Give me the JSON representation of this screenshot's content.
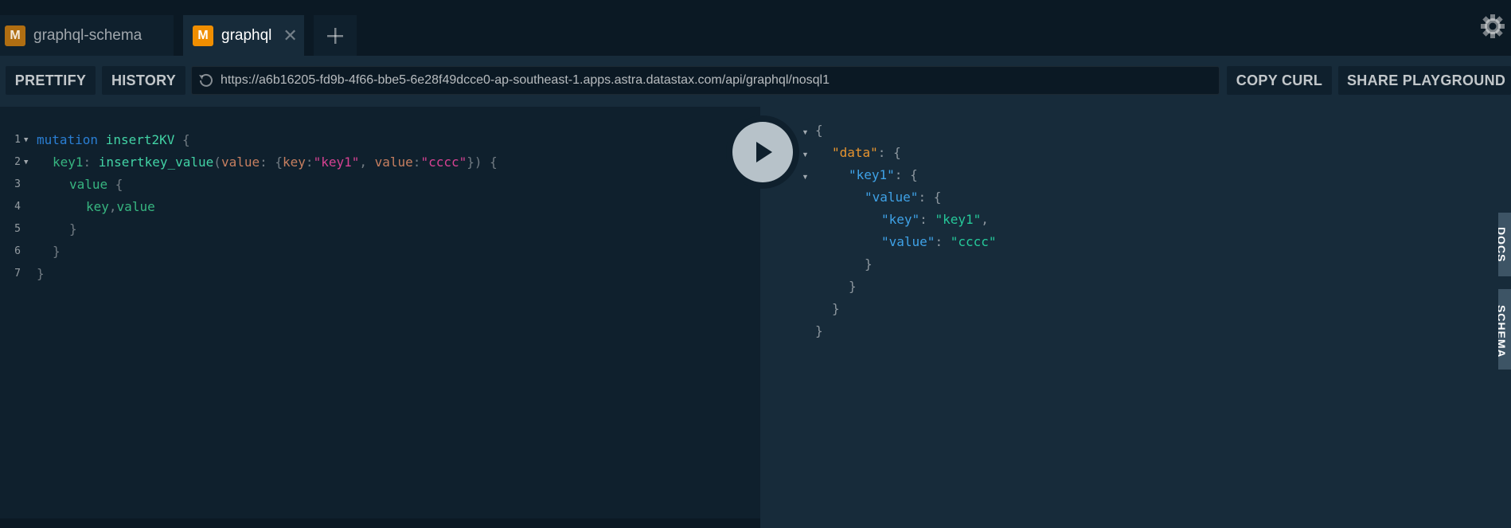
{
  "tabs": [
    {
      "badge": "M",
      "name": "graphql-schema",
      "active": false
    },
    {
      "badge": "M",
      "name": "graphql",
      "active": true,
      "close": "✕"
    }
  ],
  "toolbar": {
    "prettify": "PRETTIFY",
    "history": "HISTORY",
    "url": "https://a6b16205-fd9b-4f66-bbe5-6e28f49dcce0-ap-southeast-1.apps.astra.datastax.com/api/graphql/nosql1",
    "copy_curl": "COPY CURL",
    "share": "SHARE PLAYGROUND"
  },
  "editor": {
    "line_numbers": [
      "1",
      "2",
      "3",
      "4",
      "5",
      "6",
      "7"
    ],
    "l1": {
      "kw": "mutation",
      "name": "insert2KV",
      "brace": " {"
    },
    "l2": {
      "alias": "key1",
      "colon": ": ",
      "field": "insertkey_value",
      "open": "(",
      "arg": "value",
      "sep": ": {",
      "k1": "key",
      "c1": ":",
      "v1": "\"key1\"",
      "comma": ", ",
      "k2": "value",
      "c2": ":",
      "v2": "\"cccc\"",
      "close": "}) {"
    },
    "l3": {
      "field": "value",
      "brace": " {"
    },
    "l4": {
      "f1": "key",
      "comma": ",",
      "f2": "value"
    },
    "l5": "}",
    "l6": "}",
    "l7": "}"
  },
  "result": {
    "open": "{",
    "data_key": "\"data\"",
    "key1_key": "\"key1\"",
    "value_key": "\"value\"",
    "key_key": "\"key\"",
    "key_val": "\"key1\"",
    "value_key2": "\"value\"",
    "value_val": "\"cccc\"",
    "colon_brace": ": {",
    "colon": ": ",
    "comma": ",",
    "close": "}"
  },
  "side_tabs": {
    "docs": "DOCS",
    "schema": "SCHEMA"
  },
  "colors": {
    "background": "#0f202d",
    "accent": "#f08e00",
    "run_button": "#b7c2c9"
  }
}
